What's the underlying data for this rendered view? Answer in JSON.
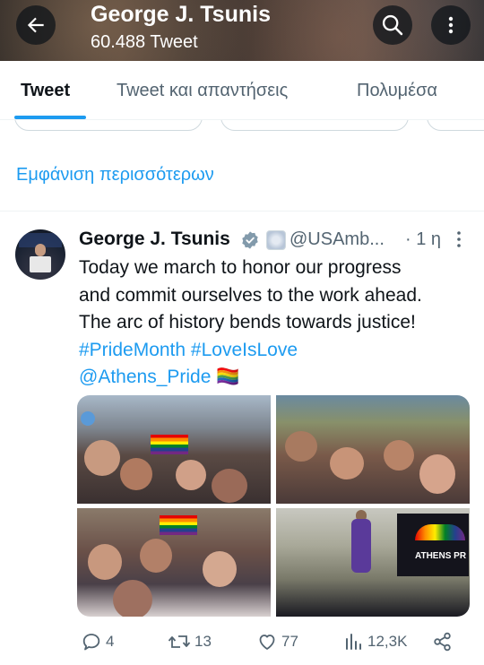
{
  "header": {
    "title": "George J. Tsunis",
    "subtitle": "60.488 Tweet"
  },
  "tabs": [
    {
      "label": "Tweet",
      "active": true
    },
    {
      "label": "Tweet και απαντήσεις",
      "active": false
    },
    {
      "label": "Πολυμέσα",
      "active": false
    }
  ],
  "show_more": "Εμφάνιση περισσότερων",
  "tweet": {
    "author_name": "George J. Tsunis",
    "handle": "@USAmb...",
    "time": "· 1 η",
    "body": {
      "line1": "Today we march to honor our progress",
      "line2": "and commit ourselves to the work ahead.",
      "line3": "The arc of history bends towards justice!",
      "hashtags": "#PrideMonth #LoveIsLove",
      "mention": "@Athens_Pride",
      "emoji": "🏳️‍🌈"
    },
    "media_text": "ATHENS PR",
    "actions": {
      "replies": "4",
      "retweets": "13",
      "likes": "77",
      "views": "12,3K"
    }
  },
  "colors": {
    "accent": "#1d9bf0",
    "text": "#0f1419",
    "muted": "#536471"
  }
}
